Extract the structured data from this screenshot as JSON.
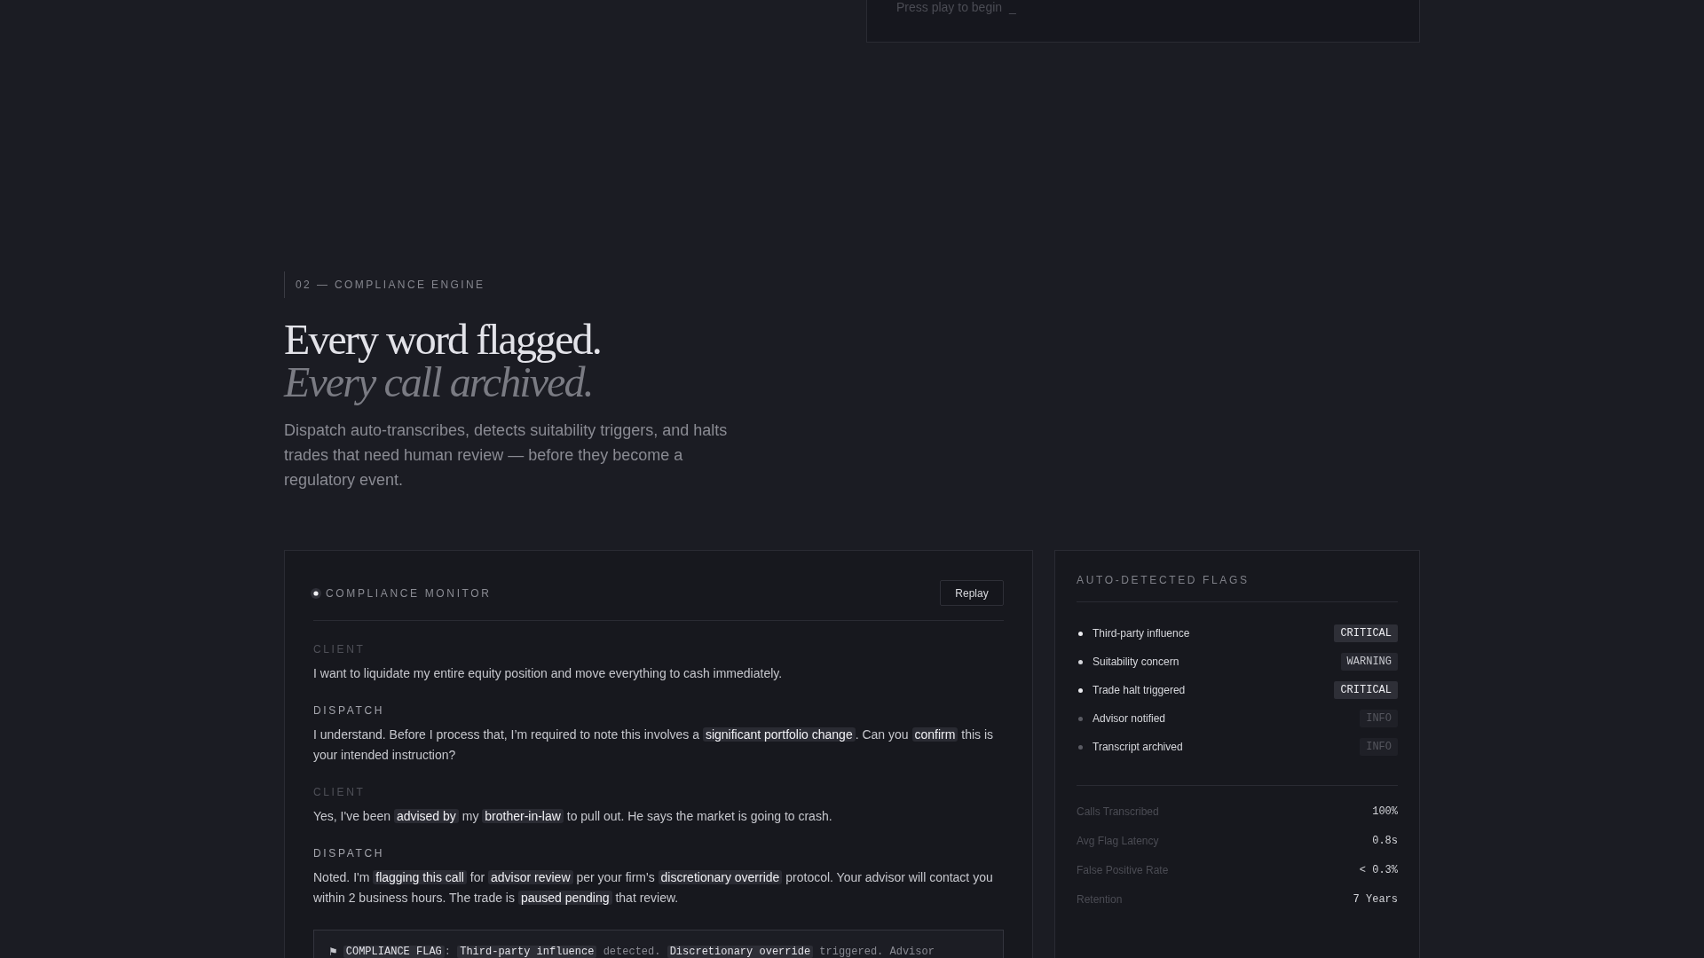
{
  "player": {
    "prompt": "Press play to begin",
    "cursor": "_"
  },
  "section": {
    "eyebrow": "02 — COMPLIANCE ENGINE",
    "headline": "Every word flagged.",
    "headline_accent": "Every call archived.",
    "description": "Dispatch auto-transcribes, detects suitability triggers, and halts trades that need human review — before they become a regulatory event."
  },
  "monitor": {
    "title": "COMPLIANCE MONITOR",
    "replay_button": "Replay",
    "messages": [
      {
        "speaker": "CLIENT",
        "kind": "client",
        "segments": [
          {
            "text": "I want to liquidate my entire equity position and move everything to cash immediately.",
            "highlight": false
          }
        ]
      },
      {
        "speaker": "DISPATCH",
        "kind": "dispatch",
        "segments": [
          {
            "text": "I understand. Before I process that, I’m required to note this involves a ",
            "highlight": false
          },
          {
            "text": "significant portfolio change",
            "highlight": true
          },
          {
            "text": ". Can you ",
            "highlight": false
          },
          {
            "text": "confirm",
            "highlight": true
          },
          {
            "text": " this is your intended instruction?",
            "highlight": false
          }
        ]
      },
      {
        "speaker": "CLIENT",
        "kind": "client",
        "segments": [
          {
            "text": "Yes, I've been ",
            "highlight": false
          },
          {
            "text": "advised by",
            "highlight": true
          },
          {
            "text": " my ",
            "highlight": false
          },
          {
            "text": "brother-in-law",
            "highlight": true
          },
          {
            "text": " to pull out. He says the market is going to crash.",
            "highlight": false
          }
        ]
      },
      {
        "speaker": "DISPATCH",
        "kind": "dispatch",
        "segments": [
          {
            "text": "Noted. I'm ",
            "highlight": false
          },
          {
            "text": "flagging this call",
            "highlight": true
          },
          {
            "text": " for ",
            "highlight": false
          },
          {
            "text": "advisor review",
            "highlight": true
          },
          {
            "text": " per your firm's ",
            "highlight": false
          },
          {
            "text": "discretionary override",
            "highlight": true
          },
          {
            "text": " protocol. Your advisor will contact you within 2 business hours. The trade is ",
            "highlight": false
          },
          {
            "text": "paused pending",
            "highlight": true
          },
          {
            "text": " that review.",
            "highlight": false
          }
        ]
      }
    ],
    "flag_note": {
      "icon": "⚑",
      "segments": [
        {
          "text": "COMPLIANCE FLAG",
          "highlight": true
        },
        {
          "text": ": ",
          "highlight": false
        },
        {
          "text": "Third-party influence",
          "highlight": true
        },
        {
          "text": " detected. ",
          "highlight": false
        },
        {
          "text": "Discretionary override",
          "highlight": true
        },
        {
          "text": " triggered. Advisor",
          "highlight": false
        }
      ]
    }
  },
  "flags_panel": {
    "title": "AUTO-DETECTED FLAGS",
    "flags": [
      {
        "label": "Third-party influence",
        "severity": "CRITICAL",
        "kind": "critical"
      },
      {
        "label": "Suitability concern",
        "severity": "WARNING",
        "kind": "warning"
      },
      {
        "label": "Trade halt triggered",
        "severity": "CRITICAL",
        "kind": "critical"
      },
      {
        "label": "Advisor notified",
        "severity": "INFO",
        "kind": "info"
      },
      {
        "label": "Transcript archived",
        "severity": "INFO",
        "kind": "info"
      }
    ],
    "stats": [
      {
        "label": "Calls Transcribed",
        "value": "100%"
      },
      {
        "label": "Avg Flag Latency",
        "value": "0.8s"
      },
      {
        "label": "False Positive Rate",
        "value": "< 0.3%"
      },
      {
        "label": "Retention",
        "value": "7 Years"
      }
    ]
  }
}
